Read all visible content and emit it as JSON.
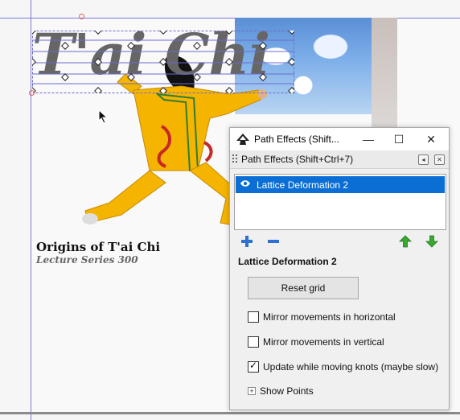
{
  "canvas": {
    "title_text": "T'ai Chi",
    "caption_title": "Origins of T'ai Chi",
    "caption_subtitle": "Lecture Series 300"
  },
  "dialog": {
    "window_title": "Path Effects  (Shift...",
    "panel_label": "Path Effects  (Shift+Ctrl+7)",
    "effects": [
      {
        "name": "Lattice Deformation 2",
        "visible": true,
        "selected": true
      }
    ],
    "section_title": "Lattice Deformation 2",
    "reset_button": "Reset grid",
    "options": [
      {
        "label": "Mirror movements in horizontal",
        "checked": false
      },
      {
        "label": "Mirror movements in vertical",
        "checked": false
      },
      {
        "label": "Update while moving knots (maybe slow)",
        "checked": true
      }
    ],
    "show_points": "Show Points"
  },
  "icons": {
    "app": "inkscape-icon",
    "eye": "eye-icon",
    "add": "plus-icon",
    "remove": "minus-icon",
    "up": "arrow-up-icon",
    "down": "arrow-down-icon"
  },
  "colors": {
    "selection": "#0a6ed4",
    "accent_green": "#3aa832",
    "guide": "#7b7bd8"
  }
}
